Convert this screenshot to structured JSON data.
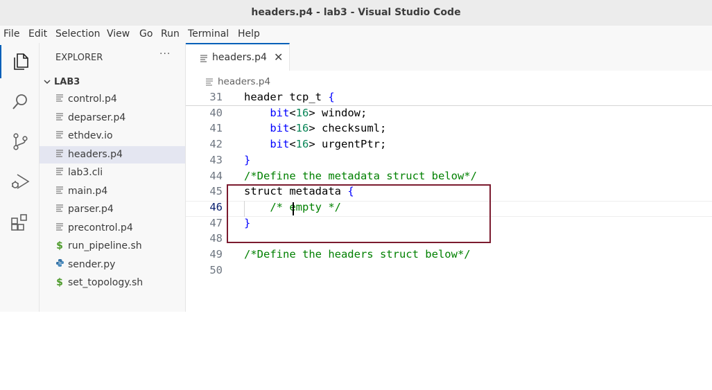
{
  "window": {
    "title": "headers.p4 - lab3 - Visual Studio Code"
  },
  "menu": [
    "File",
    "Edit",
    "Selection",
    "View",
    "Go",
    "Run",
    "Terminal",
    "Help"
  ],
  "activity_bar": [
    "explorer-icon",
    "search-icon",
    "source-control-icon",
    "run-debug-icon",
    "extensions-icon"
  ],
  "sidebar": {
    "title": "EXPLORER",
    "more": "···",
    "folder": "LAB3",
    "files": [
      {
        "name": "control.p4",
        "icon": "lines"
      },
      {
        "name": "deparser.p4",
        "icon": "lines"
      },
      {
        "name": "ethdev.io",
        "icon": "lines"
      },
      {
        "name": "headers.p4",
        "icon": "lines"
      },
      {
        "name": "lab3.cli",
        "icon": "lines"
      },
      {
        "name": "main.p4",
        "icon": "lines"
      },
      {
        "name": "parser.p4",
        "icon": "lines"
      },
      {
        "name": "precontrol.p4",
        "icon": "lines"
      },
      {
        "name": "run_pipeline.sh",
        "icon": "dollar"
      },
      {
        "name": "sender.py",
        "icon": "python"
      },
      {
        "name": "set_topology.sh",
        "icon": "dollar"
      }
    ]
  },
  "tab": {
    "label": "headers.p4",
    "close": "✕"
  },
  "breadcrumb": "headers.p4",
  "editor": {
    "lines": [
      {
        "n": "31",
        "tokens": [
          [
            "",
            "header tcp_t "
          ],
          [
            "kw",
            "{"
          ]
        ]
      },
      {
        "n": "40",
        "tokens": [
          [
            "",
            "    "
          ],
          [
            "kw",
            "bit"
          ],
          [
            "",
            "<"
          ],
          [
            "num",
            "16"
          ],
          [
            "",
            "> window;"
          ]
        ]
      },
      {
        "n": "41",
        "tokens": [
          [
            "",
            "    "
          ],
          [
            "kw",
            "bit"
          ],
          [
            "",
            "<"
          ],
          [
            "num",
            "16"
          ],
          [
            "",
            "> checksuml;"
          ]
        ]
      },
      {
        "n": "42",
        "tokens": [
          [
            "",
            "    "
          ],
          [
            "kw",
            "bit"
          ],
          [
            "",
            "<"
          ],
          [
            "num",
            "16"
          ],
          [
            "",
            "> urgentPtr;"
          ]
        ]
      },
      {
        "n": "43",
        "tokens": [
          [
            "kw",
            "}"
          ]
        ]
      },
      {
        "n": "44",
        "tokens": [
          [
            "cm",
            "/*Define the metadata struct below*/"
          ]
        ]
      },
      {
        "n": "45",
        "tokens": [
          [
            "",
            "struct metadata "
          ],
          [
            "kw",
            "{"
          ]
        ]
      },
      {
        "n": "46",
        "tokens": [
          [
            "cm",
            "    /* empty */"
          ]
        ]
      },
      {
        "n": "47",
        "tokens": [
          [
            "kw",
            "}"
          ]
        ]
      },
      {
        "n": "48",
        "tokens": []
      },
      {
        "n": "49",
        "tokens": [
          [
            "cm",
            "/*Define the headers struct below*/"
          ]
        ]
      },
      {
        "n": "50",
        "tokens": []
      }
    ]
  }
}
